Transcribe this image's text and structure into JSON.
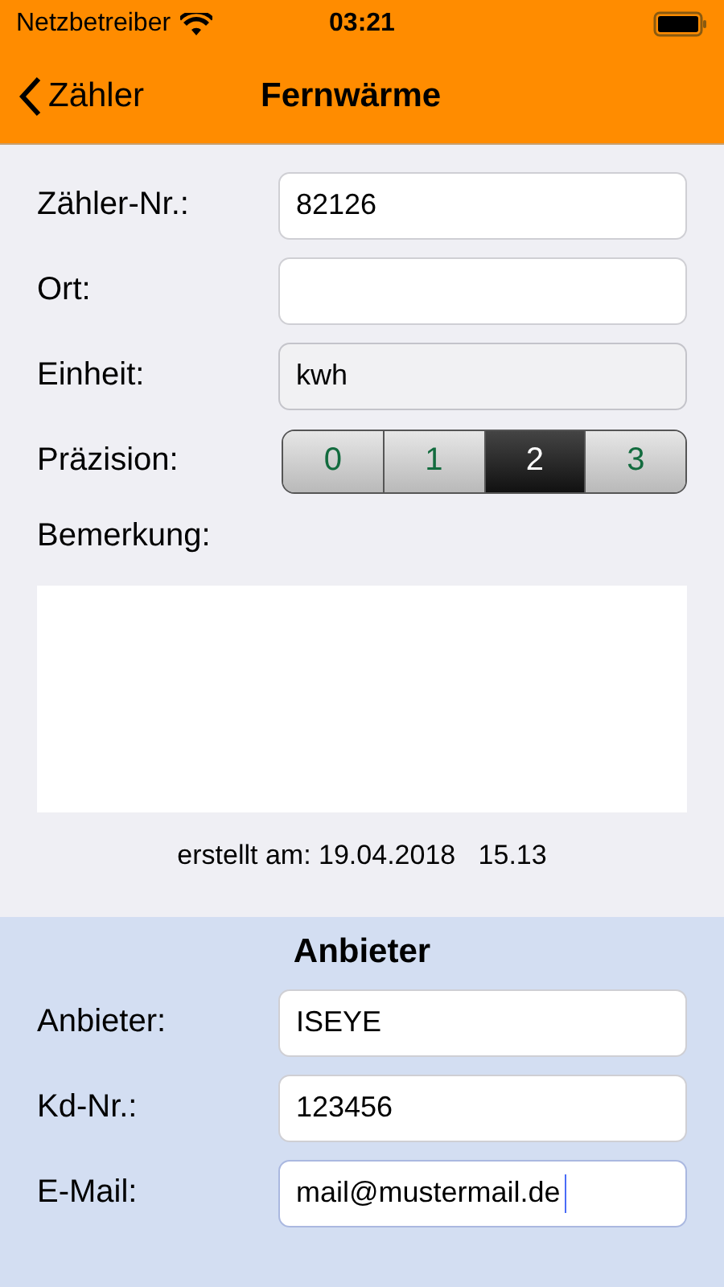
{
  "status_bar": {
    "carrier": "Netzbetreiber",
    "time": "03:21"
  },
  "nav": {
    "back": "Zähler",
    "title": "Fernwärme"
  },
  "fields": [
    {
      "label": "Zähler-Nr.:",
      "value": "82126",
      "disabled": false,
      "focused": false
    },
    {
      "label": "Ort:",
      "disabled": false,
      "focused": false
    },
    {
      "label": "Einheit:",
      "value": "kwh",
      "disabled": true,
      "focused": false
    }
  ],
  "precision": {
    "label": "Präzision:",
    "options": [
      {
        "label": "0",
        "selected": false
      },
      {
        "label": "1",
        "selected": false
      },
      {
        "label": "2",
        "selected": true
      },
      {
        "label": "3",
        "selected": false
      }
    ]
  },
  "remark": {
    "label": "Bemerkung:"
  },
  "created": "erstellt am: 19.04.2018   15.13",
  "provider": {
    "heading": "Anbieter",
    "fields": [
      {
        "label": "Anbieter:",
        "value": "ISEYE",
        "disabled": false,
        "focused": false
      },
      {
        "label": "Kd-Nr.:",
        "value": "123456",
        "disabled": false,
        "focused": false
      },
      {
        "label": "E-Mail:",
        "value": "mail@mustermail.de",
        "disabled": false,
        "focused": true
      }
    ]
  }
}
